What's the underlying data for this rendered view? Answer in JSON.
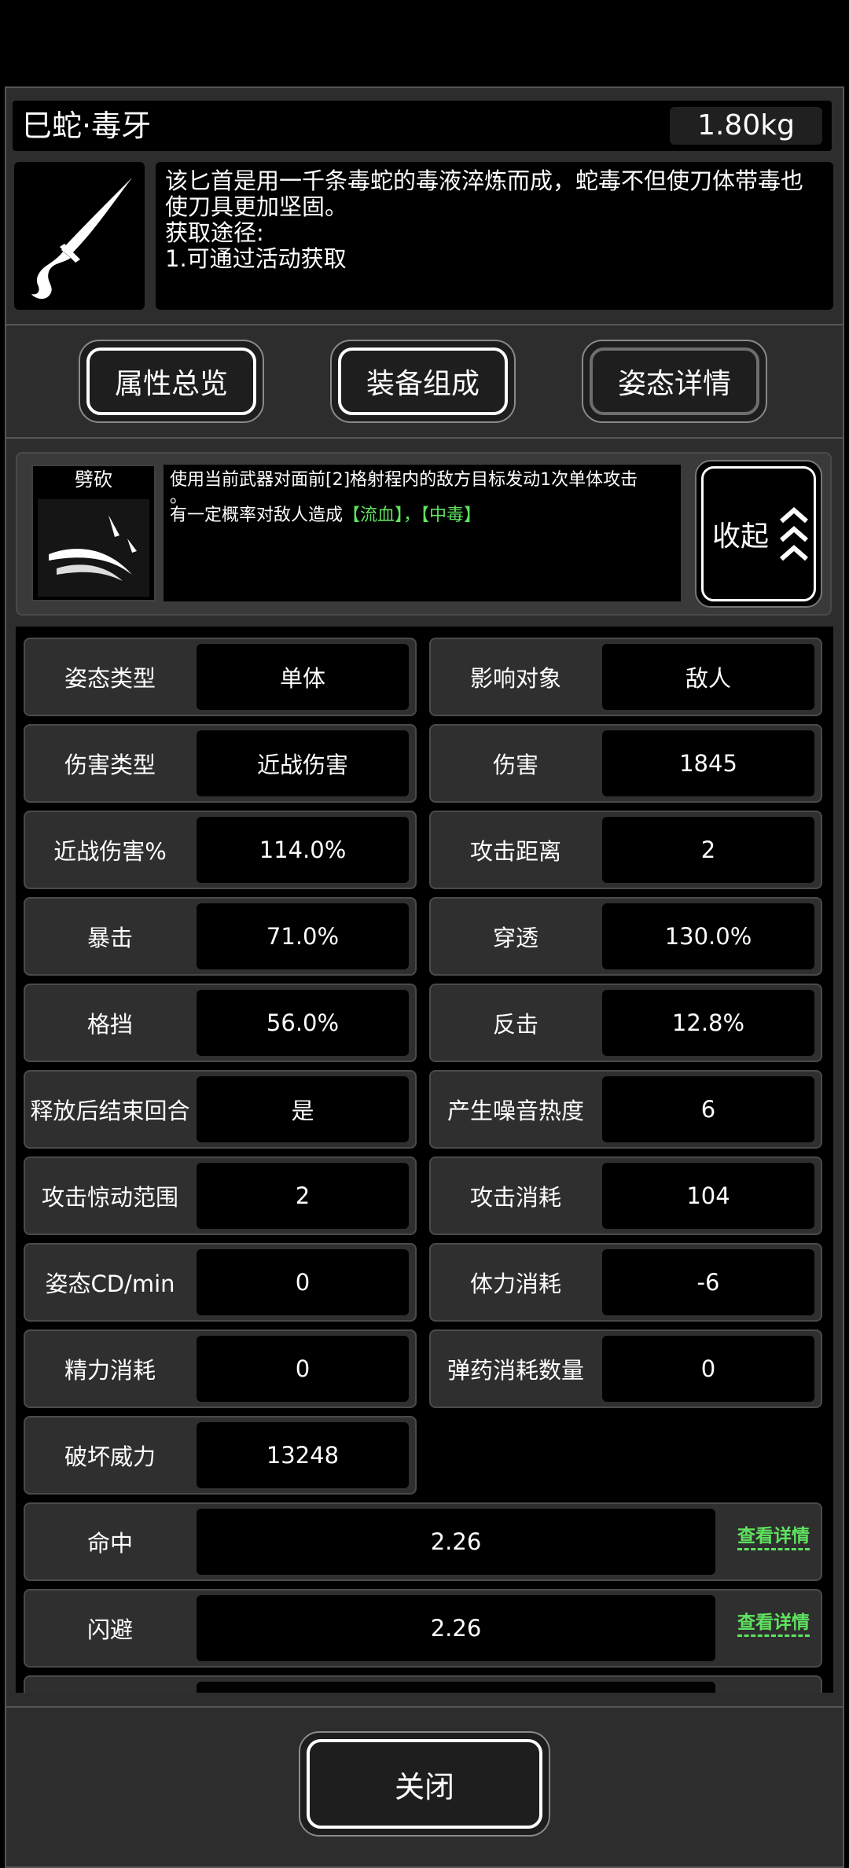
{
  "item": {
    "name": "巳蛇·毒牙",
    "weight": "1.80kg",
    "icon": "dagger-icon",
    "description": "该匕首是用一千条毒蛇的毒液淬炼而成，蛇毒不但使刀体带毒也使刀具更加坚固。",
    "source_title": "获取途径:",
    "source_line": "1.可通过活动获取"
  },
  "tabs": [
    "属性总览",
    "装备组成",
    "姿态详情"
  ],
  "skill": {
    "name": "劈砍",
    "icon": "slash-icon",
    "desc_line1": "使用当前武器对面前[2]格射程内的敌方目标发动1次单体攻击",
    "desc_line1_tail": "。",
    "desc_line2_prefix": "有一定概率对敌人造成",
    "effect1": "【流血】",
    "effect_sep": "，",
    "effect2": "【中毒】",
    "collapse_label": "收起"
  },
  "stats_left": [
    {
      "label": "姿态类型",
      "value": "单体"
    },
    {
      "label": "伤害类型",
      "value": "近战伤害"
    },
    {
      "label": "近战伤害%",
      "value": "114.0%"
    },
    {
      "label": "暴击",
      "value": "71.0%"
    },
    {
      "label": "格挡",
      "value": "56.0%"
    },
    {
      "label": "释放后结束回合",
      "value": "是"
    },
    {
      "label": "攻击惊动范围",
      "value": "2"
    },
    {
      "label": "姿态CD/min",
      "value": "0"
    },
    {
      "label": "精力消耗",
      "value": "0"
    },
    {
      "label": "破坏威力",
      "value": "13248"
    }
  ],
  "stats_right": [
    {
      "label": "影响对象",
      "value": "敌人"
    },
    {
      "label": "伤害",
      "value": "1845"
    },
    {
      "label": "攻击距离",
      "value": "2"
    },
    {
      "label": "穿透",
      "value": "130.0%"
    },
    {
      "label": "反击",
      "value": "12.8%"
    },
    {
      "label": "产生噪音热度",
      "value": "6"
    },
    {
      "label": "攻击消耗",
      "value": "104"
    },
    {
      "label": "体力消耗",
      "value": "-6"
    },
    {
      "label": "弹药消耗数量",
      "value": "0"
    }
  ],
  "stats_wide": [
    {
      "label": "命中",
      "value": "2.26",
      "link": "查看详情"
    },
    {
      "label": "闪避",
      "value": "2.26",
      "link": "查看详情"
    }
  ],
  "close_label": "关闭",
  "colors": {
    "accent_green": "#5fe35f",
    "panel": "#2d2d2d",
    "cell": "#2f2f2f"
  }
}
